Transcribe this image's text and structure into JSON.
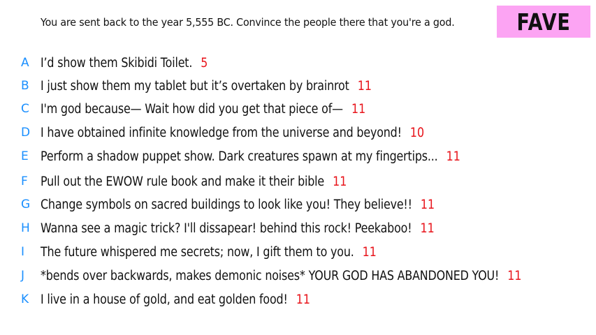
{
  "prompt": "You are sent back to the year 5,555 BC. Convince the people there that you're a god.",
  "badge": "FAVE",
  "colors": {
    "letter": "#1a8fff",
    "score": "#e8141b",
    "badge_bg": "#fca4f3",
    "text": "#111111"
  },
  "answers": [
    {
      "letter": "A",
      "text": "I’d show them Skibidi Toilet.",
      "score": "5"
    },
    {
      "letter": "B",
      "text": "I just show them my tablet but it’s overtaken by brainrot",
      "score": "11"
    },
    {
      "letter": "C",
      "text": "I'm god because— Wait how did you get that piece of—",
      "score": "11"
    },
    {
      "letter": "D",
      "text": "I have obtained infinite knowledge from the universe and beyond!",
      "score": "10"
    },
    {
      "letter": "E",
      "text": "Perform a shadow puppet show. Dark creatures spawn at my fingertips...",
      "score": "11"
    },
    {
      "letter": "F",
      "text": "Pull out the EWOW rule book and make it their bible",
      "score": "11"
    },
    {
      "letter": "G",
      "text": "Change symbols on sacred buildings to look like you! They believe!!",
      "score": "11"
    },
    {
      "letter": "H",
      "text": "Wanna see a magic trick? I'll dissapear! behind this rock! Peekaboo!",
      "score": "11"
    },
    {
      "letter": "I",
      "text": "The future whispered me secrets; now, I gift them to you.",
      "score": "11"
    },
    {
      "letter": "J",
      "text": "*bends over backwards, makes demonic noises* YOUR GOD HAS ABANDONED YOU!",
      "score": "11"
    },
    {
      "letter": "K",
      "text": "I live in a house of gold, and eat golden food!",
      "score": "11"
    }
  ]
}
